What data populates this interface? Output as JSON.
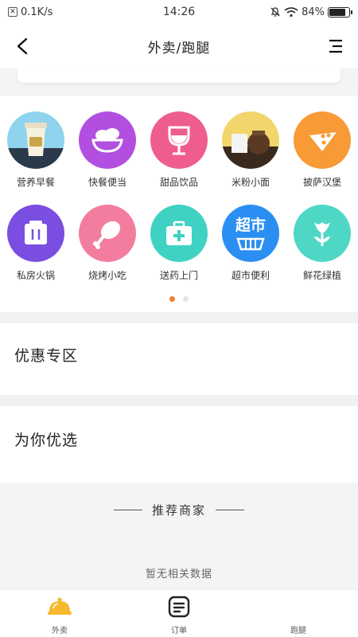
{
  "status_bar": {
    "net_speed": "0.1K/s",
    "time": "14:26",
    "battery": "84%",
    "battery_level": 0.84
  },
  "header": {
    "title": "外卖/跑腿"
  },
  "categories": {
    "row1": [
      {
        "label": "营养早餐",
        "icon": "coffee-cup-icon",
        "color": "#8fd3ef"
      },
      {
        "label": "快餐便当",
        "icon": "salad-bowl-icon",
        "color": "#b24fe0"
      },
      {
        "label": "甜品饮品",
        "icon": "wine-glass-icon",
        "color": "#ef5d8c"
      },
      {
        "label": "米粉小面",
        "icon": "drinks-icon",
        "color": "#f2d56b"
      },
      {
        "label": "披萨汉堡",
        "icon": "pizza-icon",
        "color": "#f89a36"
      }
    ],
    "row2": [
      {
        "label": "私房火锅",
        "icon": "hotpot-icon",
        "color": "#7a4ee0"
      },
      {
        "label": "烧烤小吃",
        "icon": "drumstick-icon",
        "color": "#f37d9f"
      },
      {
        "label": "送药上门",
        "icon": "medicine-box-icon",
        "color": "#3fd2c2"
      },
      {
        "label": "超市便利",
        "icon": "supermarket-icon",
        "color": "#2b8ef2",
        "badge": "超市"
      },
      {
        "label": "鲜花绿植",
        "icon": "flower-icon",
        "color": "#4fd7c5"
      }
    ],
    "pages": 2,
    "active_page": 1
  },
  "sections": {
    "discount": "优惠专区",
    "selected": "为你优选"
  },
  "recommend": {
    "title": "推荐商家",
    "empty": "暂无相关数据"
  },
  "tabbar": {
    "items": [
      {
        "label": "外卖",
        "icon": "food-cloche-icon"
      },
      {
        "label": "订单",
        "icon": "order-list-icon"
      },
      {
        "label": "跑腿",
        "icon": "errand-icon"
      }
    ],
    "accent": "#f5b82e"
  }
}
